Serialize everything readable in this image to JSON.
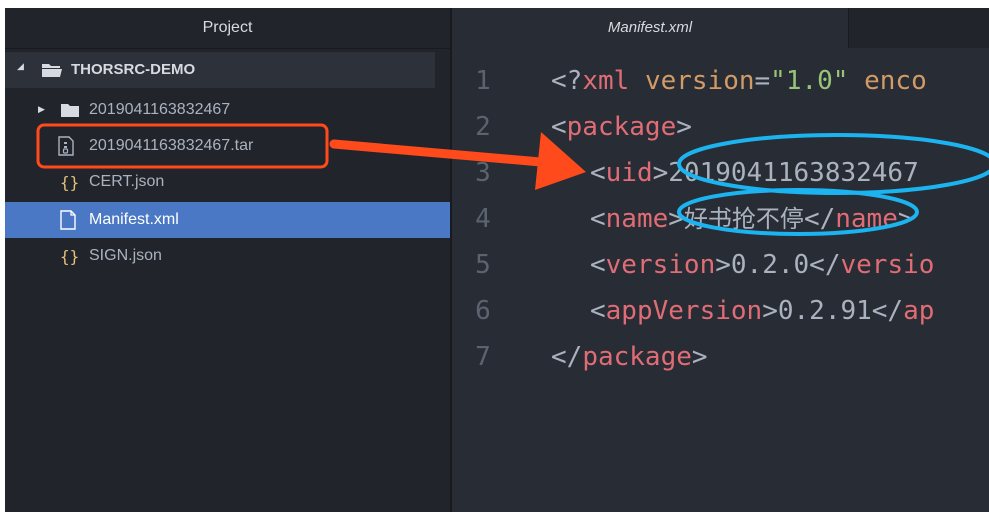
{
  "sidebar": {
    "title": "Project",
    "root": {
      "label": "THORSRC-DEMO"
    },
    "items": [
      {
        "label": "2019041163832467",
        "type": "folder"
      },
      {
        "label": "2019041163832467.tar",
        "type": "archive"
      },
      {
        "label": "CERT.json",
        "type": "json",
        "icon_text": "{}"
      },
      {
        "label": "Manifest.xml",
        "type": "file",
        "selected": true
      },
      {
        "label": "SIGN.json",
        "type": "json",
        "icon_text": "{}"
      }
    ]
  },
  "editor": {
    "tab": {
      "label": "Manifest.xml"
    },
    "lines": [
      {
        "num": "1",
        "parts": [
          "<?",
          "xml",
          " ",
          "version",
          "=",
          "\"1.0\"",
          " ",
          "enco"
        ]
      },
      {
        "num": "2",
        "parts": [
          "<",
          "package",
          ">"
        ]
      },
      {
        "num": "3",
        "parts": [
          "<",
          "uid",
          ">",
          "2019041163832467"
        ]
      },
      {
        "num": "4",
        "parts": [
          "<",
          "name",
          ">",
          "好书抢不停",
          "</",
          "name",
          ">"
        ]
      },
      {
        "num": "5",
        "parts": [
          "<",
          "version",
          ">",
          "0.2.0",
          "</",
          "versio"
        ]
      },
      {
        "num": "6",
        "parts": [
          "<",
          "appVersion",
          ">",
          "0.2.91",
          "</",
          "ap"
        ]
      },
      {
        "num": "7",
        "parts": [
          "</",
          "package",
          ">"
        ]
      }
    ]
  },
  "colors": {
    "selection": "#4a78c4",
    "annotation_red": "#ff4a1c",
    "annotation_blue": "#1cb4f0"
  }
}
